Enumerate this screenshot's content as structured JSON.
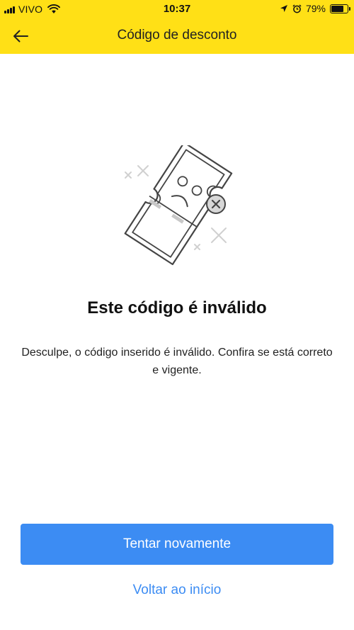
{
  "status_bar": {
    "carrier": "VIVO",
    "time": "10:37",
    "battery_percent": "79%",
    "battery_level": 0.79
  },
  "nav": {
    "title": "Código de desconto",
    "back_icon": "arrow-left-icon"
  },
  "illustration": {
    "icon": "invalid-ticket-sad-face-icon"
  },
  "content": {
    "headline": "Este código é inválido",
    "message": "Desculpe, o código inserido é inválido. Confira se está correto e vigente."
  },
  "actions": {
    "retry_label": "Tentar novamente",
    "home_label": "Voltar ao início"
  },
  "colors": {
    "header_yellow": "#FFE016",
    "primary_blue": "#3C8CF3"
  }
}
